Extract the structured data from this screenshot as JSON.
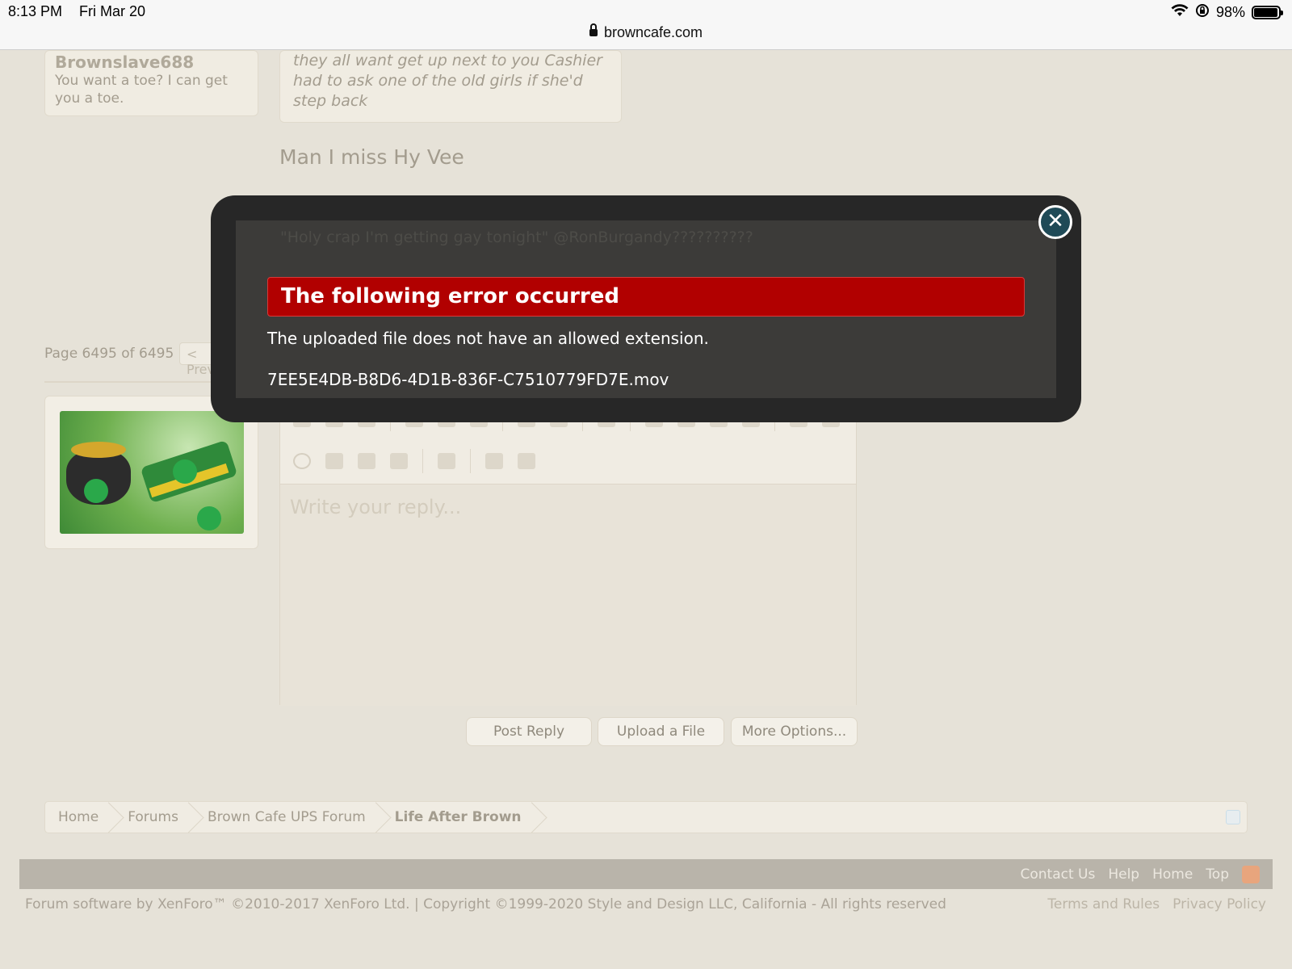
{
  "status_bar": {
    "time": "8:13 PM",
    "date": "Fri Mar 20",
    "battery": "98%",
    "battery_level": 0.98,
    "icons": [
      "wifi-icon",
      "orientation-lock-icon",
      "battery-icon"
    ]
  },
  "browser": {
    "url": "browncafe.com",
    "lock_icon": "lock-icon"
  },
  "thread": {
    "quote_author": "Brownslave688",
    "quote_author_text": "You want a toe? I can get you a toe.",
    "quote_text": "they all want get up next to you Cashier had to ask one of the old girls if she'd step back",
    "post_text": "Man I miss Hy Vee",
    "behind_modal_text": "\"Holy crap I'm getting gay tonight\" @RonBurgandy??????????",
    "pager_text": "Page 6495 of 6495",
    "prev_label": "< Prev"
  },
  "editor": {
    "placeholder": "Write your reply...",
    "row1_icons": [
      "bold-icon",
      "italic-icon",
      "underline-icon",
      "font-color-icon",
      "font-size-icon",
      "font-family-icon",
      "link-icon",
      "unlink-icon",
      "align-icon",
      "bulleted-list-icon",
      "numbered-list-icon",
      "indent-icon",
      "outdent-icon",
      "remove-format-icon",
      "source-icon"
    ],
    "row2_icons": [
      "smilies-icon",
      "image-icon",
      "media-icon",
      "quote-icon",
      "save-draft-icon",
      "undo-icon",
      "redo-icon"
    ]
  },
  "buttons": {
    "post_reply": "Post Reply",
    "upload_file": "Upload a File",
    "more_options": "More Options..."
  },
  "breadcrumb": {
    "items": [
      "Home",
      "Forums",
      "Brown Cafe UPS Forum",
      "Life After Brown"
    ]
  },
  "footer": {
    "links": [
      "Contact Us",
      "Help",
      "Home",
      "Top"
    ],
    "copyright": "Forum software by XenForo™ ©2010-2017 XenForo Ltd. | Copyright ©1999-2020 Style and Design LLC, California - All rights reserved",
    "terms": "Terms and Rules",
    "privacy": "Privacy Policy"
  },
  "modal": {
    "title": "The following error occurred",
    "message": "The uploaded file does not have an allowed extension.",
    "filename": "7EE5E4DB-B8D6-4D1B-836F-C7510779FD7E.mov",
    "close_icon": "close-icon"
  },
  "colors": {
    "error_red": "#b10000",
    "modal_bg": "#272727",
    "page_bg": "#e6e2d8"
  }
}
